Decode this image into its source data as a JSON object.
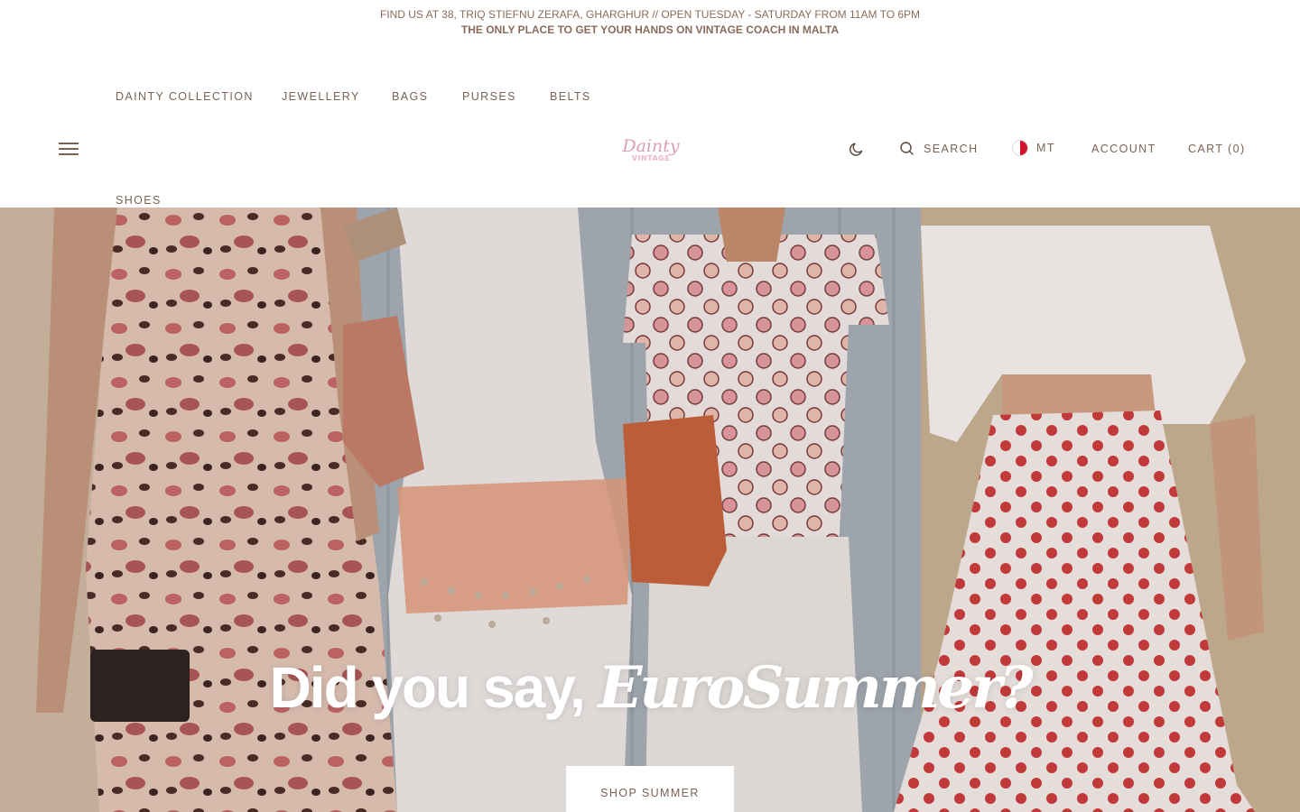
{
  "announcement": {
    "line1": "FIND US AT 38, TRIQ STIEFNU ZERAFA, GHARGHUR // OPEN TUESDAY - SATURDAY FROM 11AM TO 6PM",
    "line2": "THE ONLY PLACE TO GET YOUR HANDS ON VINTAGE COACH IN MALTA"
  },
  "nav": {
    "items": [
      {
        "label": "DAINTY COLLECTION"
      },
      {
        "label": "JEWELLERY"
      },
      {
        "label": "BAGS"
      },
      {
        "label": "PURSES"
      },
      {
        "label": "BELTS"
      },
      {
        "label": "SHOES"
      }
    ]
  },
  "logo": {
    "text_top": "Dainty",
    "text_bottom": "VINTAGE"
  },
  "header_actions": {
    "theme_icon": "moon-icon",
    "search_icon": "search-icon",
    "search_label": "SEARCH",
    "locale_flag": "malta-flag-icon",
    "locale_label": "MT",
    "account_label": "ACCOUNT",
    "cart_label": "CART (0)"
  },
  "hero": {
    "title_plain": "Did you say, ",
    "title_script": "EuroSummer?",
    "cta_label": "SHOP SUMMER"
  },
  "colors": {
    "accent_text": "#7a6255",
    "logo_pink": "#e8a3b8",
    "hero_overlay": "#463223"
  }
}
